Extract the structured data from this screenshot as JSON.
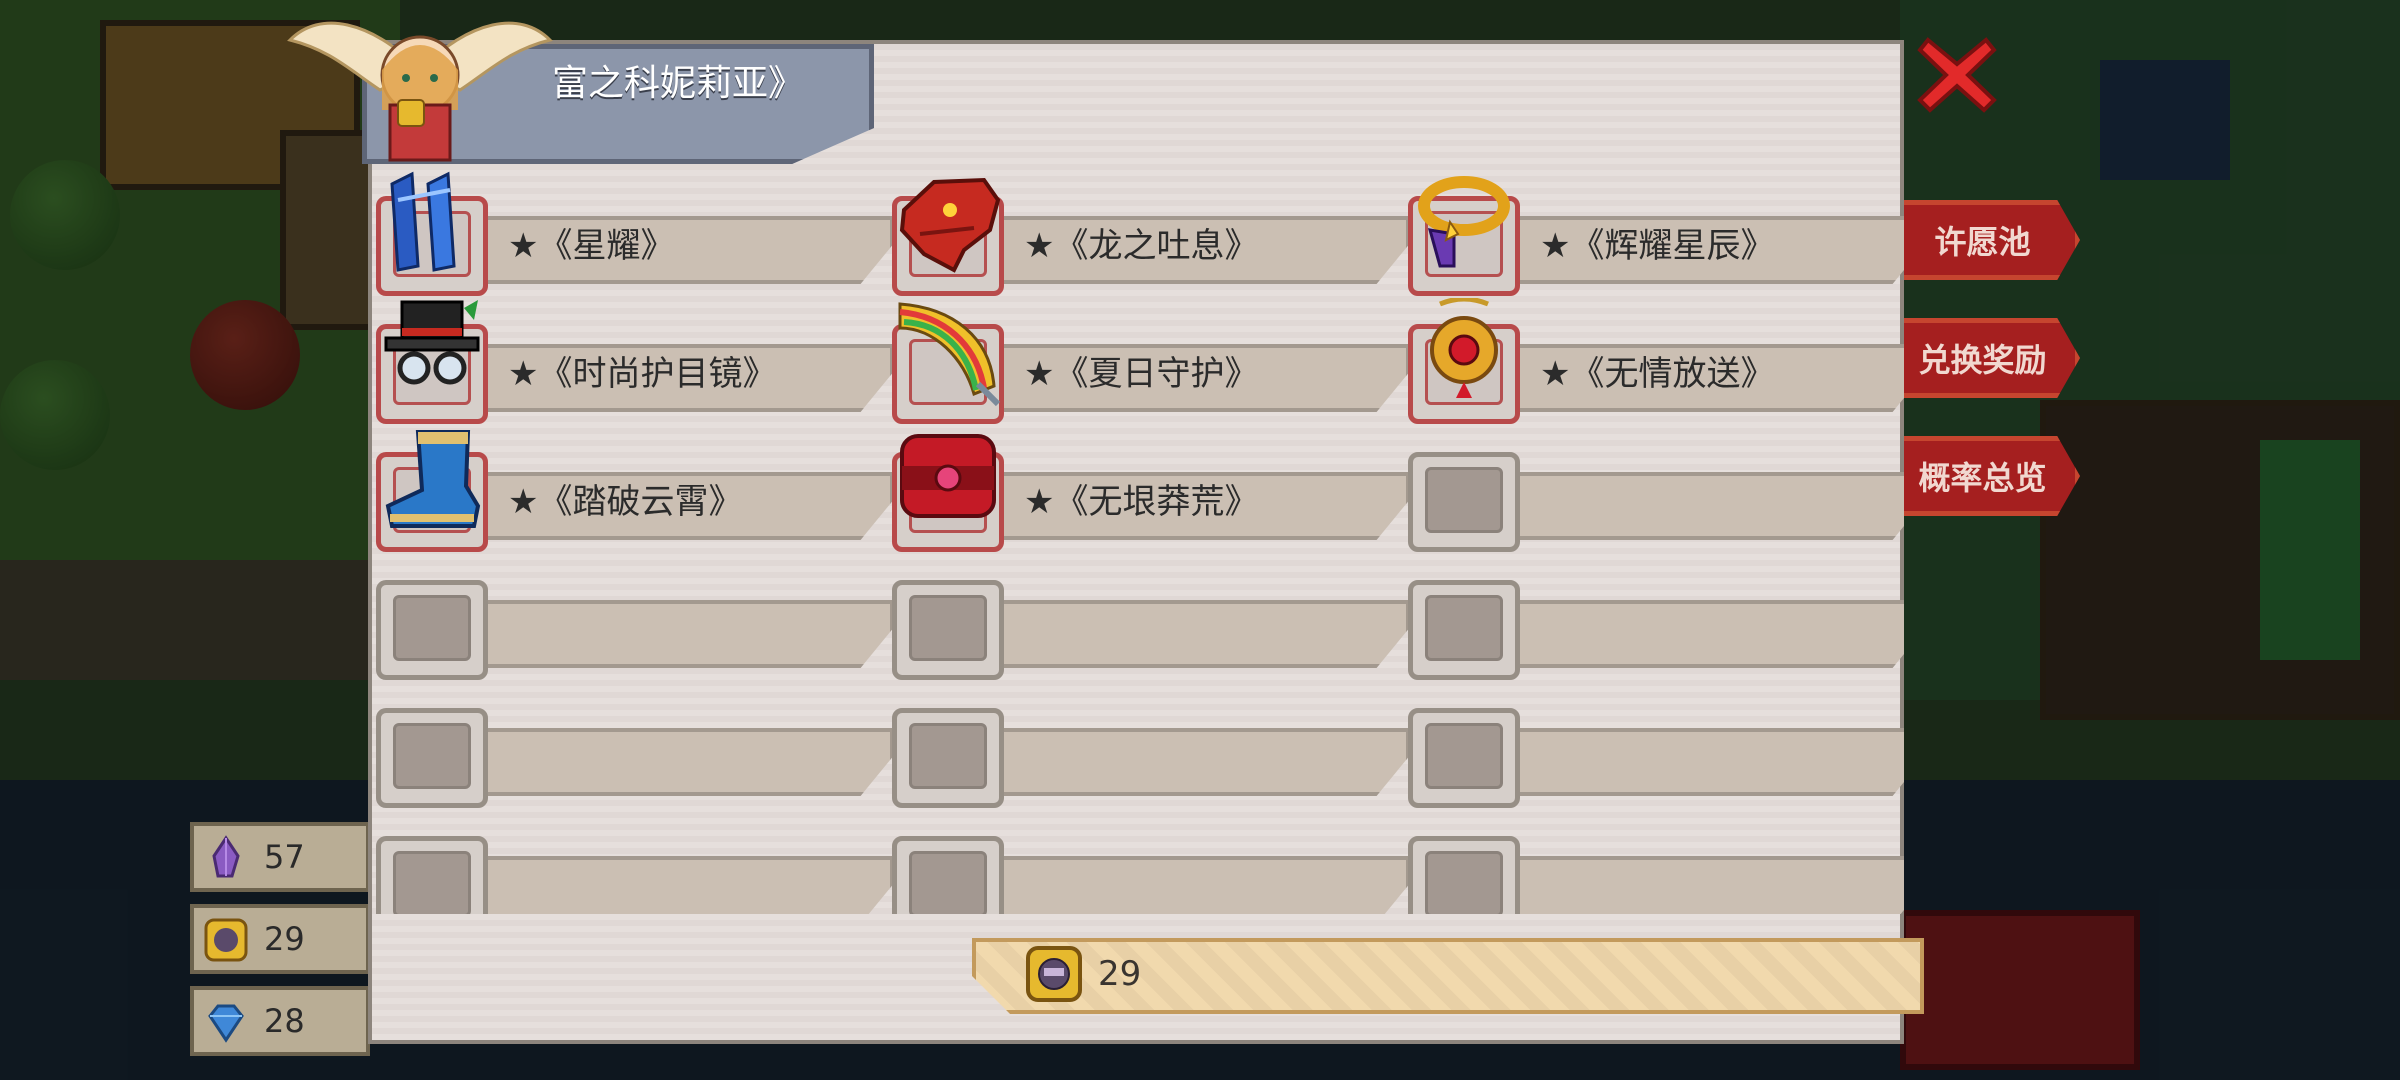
{
  "panel": {
    "title": "富之科妮莉亚》",
    "footer_count": "29"
  },
  "side_menu": [
    {
      "label": "许愿池"
    },
    {
      "label": "兑换奖励"
    },
    {
      "label": "概率总览"
    }
  ],
  "resources": [
    {
      "icon": "purple-crystal-icon",
      "value": "57"
    },
    {
      "icon": "coin-token-icon",
      "value": "29"
    },
    {
      "icon": "blue-gem-icon",
      "value": "28"
    }
  ],
  "items": [
    {
      "name": "★《星耀》",
      "icon": "blue-pillar-icon"
    },
    {
      "name": "★《龙之吐息》",
      "icon": "red-dragon-head-icon"
    },
    {
      "name": "★《辉耀星辰》",
      "icon": "golden-ring-icon"
    },
    {
      "name": "★《时尚护目镜》",
      "icon": "top-hat-goggles-icon"
    },
    {
      "name": "★《夏日守护》",
      "icon": "rainbow-blade-icon"
    },
    {
      "name": "★《无情放送》",
      "icon": "golden-amulet-icon"
    },
    {
      "name": "★《踏破云霄》",
      "icon": "blue-boot-icon"
    },
    {
      "name": "★《无垠莽荒》",
      "icon": "red-belt-icon"
    },
    {
      "name": "",
      "icon": ""
    },
    {
      "name": "",
      "icon": ""
    },
    {
      "name": "",
      "icon": ""
    },
    {
      "name": "",
      "icon": ""
    },
    {
      "name": "",
      "icon": ""
    },
    {
      "name": "",
      "icon": ""
    },
    {
      "name": "",
      "icon": ""
    },
    {
      "name": "",
      "icon": ""
    },
    {
      "name": "",
      "icon": ""
    },
    {
      "name": "",
      "icon": ""
    }
  ],
  "colors": {
    "panel_bg": "#e6dfdc",
    "banner": "#8c96aa",
    "close_red": "#e22a2a",
    "side_button": "#a51f1f",
    "footer_ribbon": "#f1d9ad"
  }
}
